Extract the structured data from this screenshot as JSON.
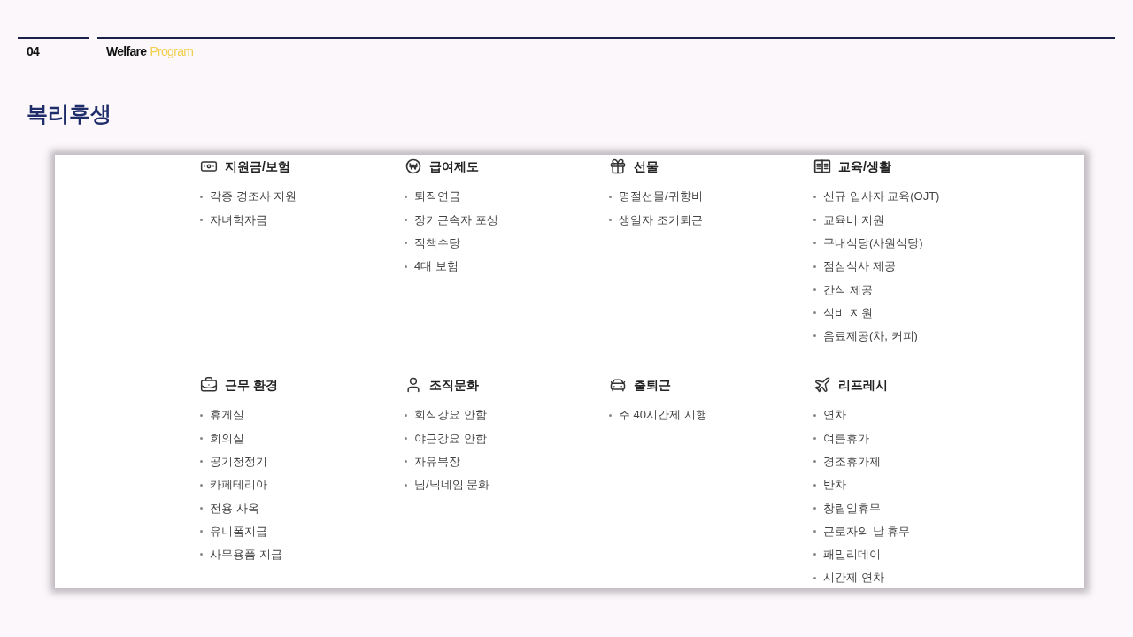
{
  "header": {
    "number": "04",
    "title": "Welfare",
    "title_accent": "Program"
  },
  "page_title": "복리후생",
  "sections": [
    {
      "title": "지원금/보험",
      "items": [
        "각종 경조사 지원",
        "자녀학자금"
      ]
    },
    {
      "title": "급여제도",
      "items": [
        "퇴직연금",
        "장기근속자 포상",
        "직책수당",
        "4대 보험"
      ]
    },
    {
      "title": "선물",
      "items": [
        "명절선물/귀향비",
        "생일자 조기퇴근"
      ]
    },
    {
      "title": "교육/생활",
      "items": [
        "신규 입사자 교육(OJT)",
        "교육비 지원",
        "구내식당(사원식당)",
        "점심식사 제공",
        "간식 제공",
        "식비 지원",
        "음료제공(차, 커피)"
      ]
    },
    {
      "title": "근무 환경",
      "items": [
        "휴게실",
        "회의실",
        "공기청정기",
        "카페테리아",
        "전용 사옥",
        "유니폼지급",
        "사무용품 지급"
      ]
    },
    {
      "title": "조직문화",
      "items": [
        "회식강요 안함",
        "야근강요 안함",
        "자유복장",
        "님/닉네임 문화"
      ]
    },
    {
      "title": "출퇴근",
      "items": [
        "주 40시간제 시행"
      ]
    },
    {
      "title": "리프레시",
      "items": [
        "연차",
        "여름휴가",
        "경조휴가제",
        "반차",
        "창립일휴무",
        "근로자의 날 휴무",
        "패밀리데이",
        "시간제 연차"
      ]
    }
  ]
}
